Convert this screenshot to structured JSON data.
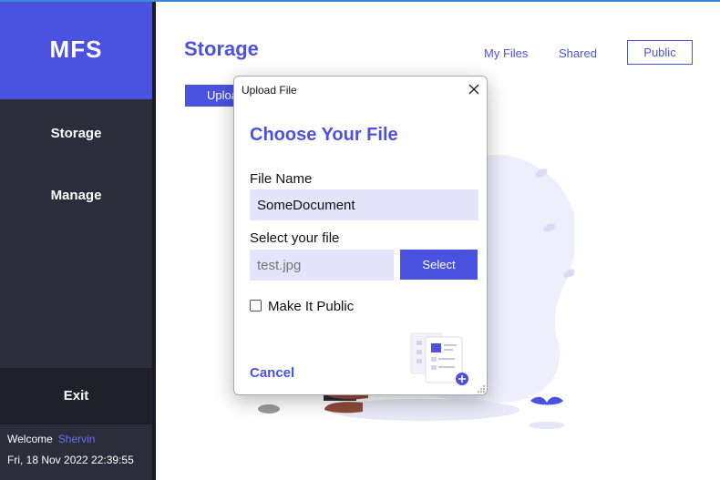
{
  "app": {
    "brand": "MFS"
  },
  "sidebar": {
    "items": [
      {
        "label": "Storage"
      },
      {
        "label": "Manage"
      }
    ],
    "exit_label": "Exit",
    "welcome_label": "Welcome",
    "username": "Shervin",
    "datetime": "Fri, 18 Nov 2022 22:39:55"
  },
  "main": {
    "title": "Storage",
    "tabs": [
      {
        "label": "My Files"
      },
      {
        "label": "Shared"
      },
      {
        "label": "Public"
      }
    ],
    "upload_button_label": "Upload"
  },
  "dialog": {
    "window_title": "Upload File",
    "heading": "Choose Your File",
    "file_name_label": "File Name",
    "file_name_value": "SomeDocument",
    "select_file_label": "Select your file",
    "selected_file_placeholder": "test.jpg",
    "select_button_label": "Select",
    "make_public_label": "Make It Public",
    "make_public_checked": false,
    "cancel_label": "Cancel"
  },
  "colors": {
    "accent": "#4c52e0",
    "sidebar": "#2b2d3a",
    "input_bg": "#e6e4fb"
  }
}
